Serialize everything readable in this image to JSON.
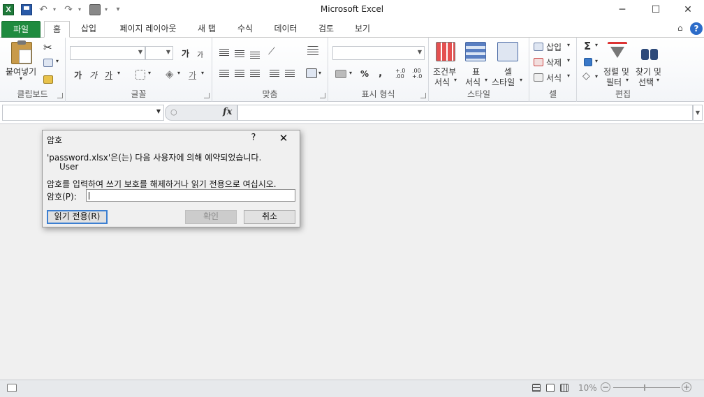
{
  "window": {
    "title": "Microsoft Excel",
    "minimize": "─",
    "maximize": "☐",
    "close": "✕"
  },
  "qat": {
    "excel_icon": "X",
    "undo_glyph": "↶",
    "redo_glyph": "↷",
    "dropdown_glyph": "▾"
  },
  "tabs": [
    {
      "label": "파일"
    },
    {
      "label": "홈"
    },
    {
      "label": "삽입"
    },
    {
      "label": "페이지 레이아웃"
    },
    {
      "label": "새 탭"
    },
    {
      "label": "수식"
    },
    {
      "label": "데이터"
    },
    {
      "label": "검토"
    },
    {
      "label": "보기"
    }
  ],
  "ribbon": {
    "clipboard": {
      "paste": "붙여넣기",
      "label": "클립보드"
    },
    "font": {
      "label": "글꼴",
      "grow": "가",
      "shrink": "가",
      "bold": "가",
      "italic": "가",
      "underline": "가",
      "fontcolor": "가"
    },
    "alignment": {
      "label": "맞춤"
    },
    "number": {
      "label": "표시 형식",
      "percent": "%",
      "comma": ",",
      "inc": "+.0 .00",
      "dec": ".00 +.0"
    },
    "styles": {
      "label": "스타일",
      "conditional_1": "조건부",
      "conditional_2": "서식",
      "table_1": "표",
      "table_2": "서식",
      "cell_1": "셀",
      "cell_2": "스타일"
    },
    "cells": {
      "label": "셀",
      "insert": "삽입",
      "delete": "삭제",
      "format": "서식"
    },
    "editing": {
      "label": "편집",
      "sigma": "Σ",
      "sort_1": "정렬 및",
      "sort_2": "필터",
      "find_1": "찾기 및",
      "find_2": "선택"
    }
  },
  "formula_bar": {
    "fx": "fx",
    "name_value": "",
    "formula_value": ""
  },
  "statusbar": {
    "zoom": "10%",
    "zoom_minus": "−",
    "zoom_plus": "+"
  },
  "dialog": {
    "title": "암호",
    "help": "?",
    "close": "✕",
    "line1": "'password.xlsx'은(는) 다음 사용자에 의해 예약되었습니다.",
    "line2": "User",
    "line3": "암호를 입력하여 쓰기 보호를 해제하거나 읽기 전용으로 여십시오.",
    "password_label": "암호(P):",
    "password_value": "",
    "readonly_button": "읽기 전용(R)",
    "ok_button": "확인",
    "cancel_button": "취소"
  }
}
